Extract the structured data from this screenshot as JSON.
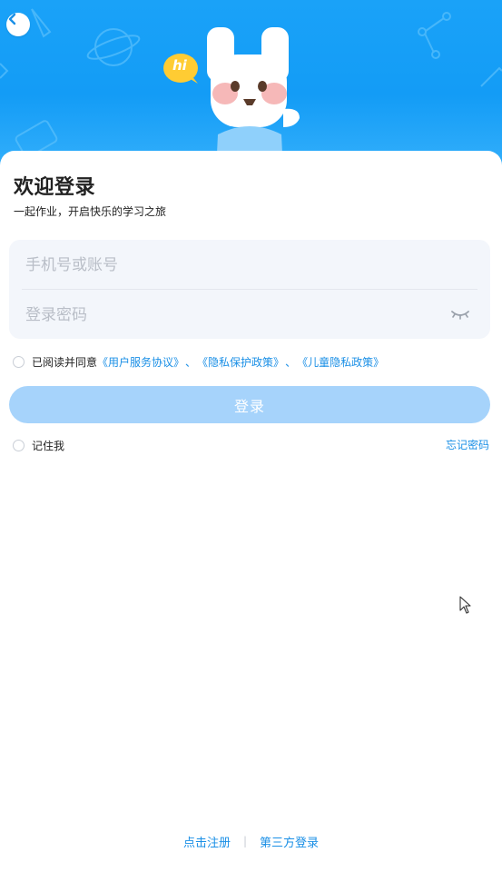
{
  "header": {
    "back_icon": "chevron-left-icon",
    "mascot_greeting": "hi",
    "colors": {
      "banner": "#1aa2f8",
      "accent": "#1a8fe6",
      "button_disabled": "#a6d3fb"
    }
  },
  "welcome": {
    "title": "欢迎登录",
    "subtitle": "一起作业，开启快乐的学习之旅"
  },
  "form": {
    "phone_placeholder": "手机号或账号",
    "password_placeholder": "登录密码",
    "phone_value": "",
    "password_value": "",
    "eye_icon": "eye-closed-icon"
  },
  "agreement": {
    "prefix": "已阅读并同意",
    "links": [
      "《用户服务协议》",
      "《隐私保护政策》",
      "《儿童隐私政策》"
    ],
    "separator": "、"
  },
  "login_button": {
    "label": "登录"
  },
  "remember": {
    "label": "记住我"
  },
  "forgot": {
    "label": "忘记密码"
  },
  "footer": {
    "register": "点击注册",
    "divider": "|",
    "third_party": "第三方登录"
  }
}
